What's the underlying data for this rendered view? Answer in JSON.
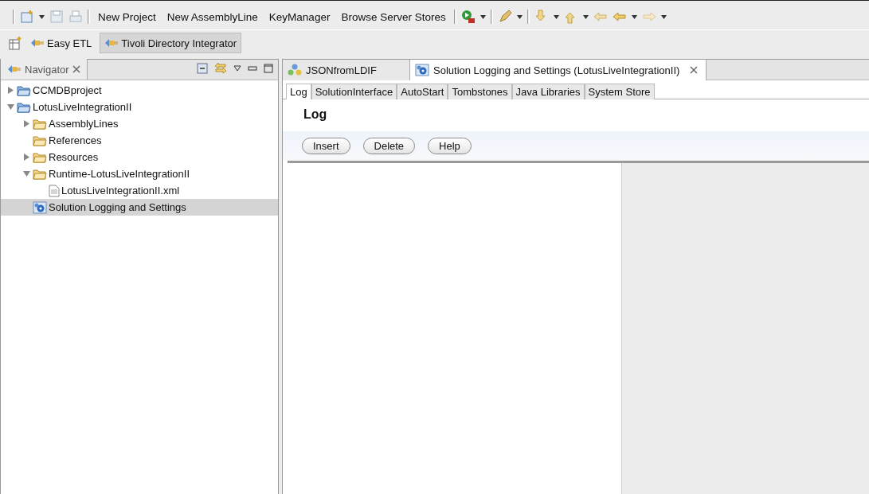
{
  "toolbar": {
    "buttons": [
      "New Project",
      "New AssemblyLine",
      "KeyManager",
      "Browse Server Stores"
    ]
  },
  "perspectives": [
    {
      "label": "Easy ETL",
      "selected": false
    },
    {
      "label": "Tivoli Directory Integrator",
      "selected": true
    }
  ],
  "navigator": {
    "title": "Navigator",
    "tree": [
      {
        "label": "CCMDBproject",
        "kind": "project",
        "expanded": false,
        "selected": false
      },
      {
        "label": "LotusLiveIntegrationII",
        "kind": "project",
        "expanded": true,
        "selected": false,
        "children": [
          {
            "label": "AssemblyLines",
            "kind": "folder",
            "expanded": false,
            "selected": false
          },
          {
            "label": "References",
            "kind": "folder",
            "selected": false
          },
          {
            "label": "Resources",
            "kind": "folder",
            "expanded": false,
            "selected": false
          },
          {
            "label": "Runtime-LotusLiveIntegrationII",
            "kind": "folder",
            "expanded": true,
            "selected": false,
            "children": [
              {
                "label": "LotusLiveIntegrationII.xml",
                "kind": "file",
                "selected": false
              }
            ]
          },
          {
            "label": "Solution Logging and Settings",
            "kind": "settings",
            "selected": true
          }
        ]
      }
    ]
  },
  "editor_tabs": [
    {
      "label": "JSONfromLDIF",
      "kind": "assembly",
      "selected": false
    },
    {
      "label": "Solution Logging and Settings (LotusLiveIntegrationII)",
      "kind": "settings",
      "selected": true
    }
  ],
  "sub_tabs": [
    {
      "label": "Log",
      "selected": true
    },
    {
      "label": "SolutionInterface",
      "selected": false
    },
    {
      "label": "AutoStart",
      "selected": false
    },
    {
      "label": "Tombstones",
      "selected": false
    },
    {
      "label": "Java Libraries",
      "selected": false
    },
    {
      "label": "System Store",
      "selected": false
    }
  ],
  "section": {
    "title": "Log",
    "buttons": [
      "Insert",
      "Delete",
      "Help"
    ]
  }
}
